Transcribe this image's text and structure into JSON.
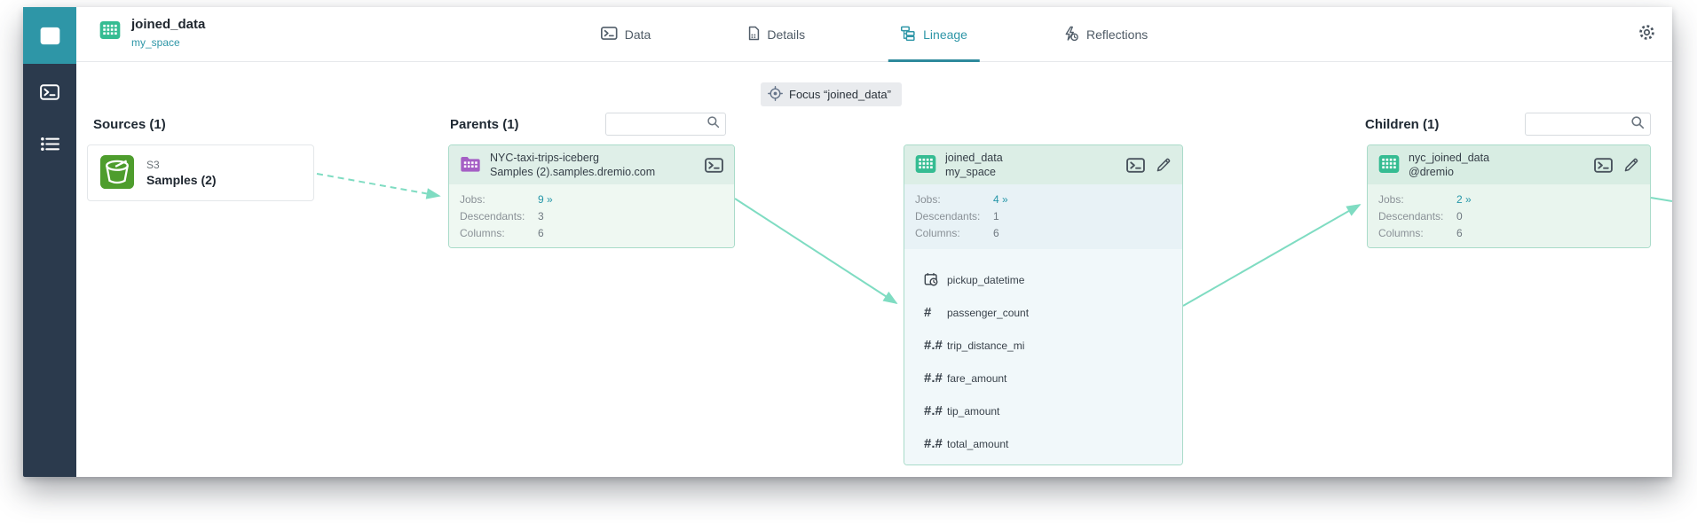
{
  "header": {
    "dataset": {
      "title": "joined_data",
      "space": "my_space"
    },
    "tabs": [
      {
        "label": "Data"
      },
      {
        "label": "Details"
      },
      {
        "label": "Lineage"
      },
      {
        "label": "Reflections"
      }
    ]
  },
  "toolbar": {
    "focus_label": "Focus “joined_data”"
  },
  "lineage": {
    "sources": {
      "heading": "Sources (1)",
      "card": {
        "type_label": "S3",
        "name": "Samples (2)"
      }
    },
    "parents": {
      "heading": "Parents (1)",
      "search": {
        "placeholder": "",
        "value": ""
      },
      "card": {
        "title": "NYC-taxi-trips-iceberg",
        "subtitle": "Samples (2).samples.dremio.com",
        "stats": [
          {
            "label": "Jobs:",
            "value": "9 »",
            "link": true
          },
          {
            "label": "Descendants:",
            "value": "3"
          },
          {
            "label": "Columns:",
            "value": "6"
          }
        ]
      }
    },
    "focused": {
      "card": {
        "title": "joined_data",
        "subtitle": "my_space",
        "stats": [
          {
            "label": "Jobs:",
            "value": "4 »",
            "link": true
          },
          {
            "label": "Descendants:",
            "value": "1"
          },
          {
            "label": "Columns:",
            "value": "6"
          }
        ],
        "columns": [
          {
            "name": "pickup_datetime",
            "type": "datetime"
          },
          {
            "name": "passenger_count",
            "type": "integer"
          },
          {
            "name": "trip_distance_mi",
            "type": "float"
          },
          {
            "name": "fare_amount",
            "type": "float"
          },
          {
            "name": "tip_amount",
            "type": "float"
          },
          {
            "name": "total_amount",
            "type": "float"
          }
        ]
      }
    },
    "children": {
      "heading": "Children (1)",
      "search": {
        "placeholder": "",
        "value": ""
      },
      "card": {
        "title": "nyc_joined_data",
        "subtitle": "@dremio",
        "stats": [
          {
            "label": "Jobs:",
            "value": "2 »",
            "link": true
          },
          {
            "label": "Descendants:",
            "value": "0"
          },
          {
            "label": "Columns:",
            "value": "6"
          }
        ]
      }
    }
  },
  "icons": {
    "integer_glyph": "#",
    "float_glyph": "#.#"
  },
  "colors": {
    "accent_teal": "#2E96A7",
    "sidebar_navy": "#2B3A4D",
    "connector_mint": "#7FDCC2",
    "card_border": "#A9DBC9",
    "dataset_green": "#35BC92",
    "dataset_purple": "#A55FC5",
    "s3_green": "#4E9D2D"
  }
}
